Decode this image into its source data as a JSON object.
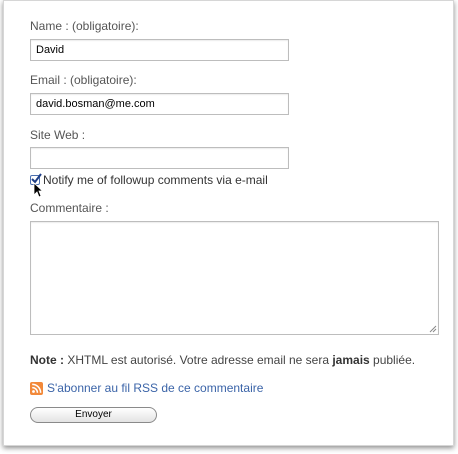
{
  "form": {
    "name_label": "Name : (obligatoire):",
    "name_value": "David",
    "email_label": "Email : (obligatoire):",
    "email_value": "david.bosman@me.com",
    "website_label": "Site Web :",
    "website_value": "",
    "notify_label": "Notify me of followup comments via e-mail",
    "notify_checked": true,
    "comment_label": "Commentaire :",
    "comment_value": ""
  },
  "note": {
    "prefix": "Note :",
    "text_before": " XHTML est autorisé. Votre adresse email ne sera ",
    "emphasis": "jamais",
    "text_after": " publiée."
  },
  "rss": {
    "icon": "rss-icon",
    "link_text": "S'abonner au fil RSS de ce commentaire"
  },
  "submit": {
    "label": "Envoyer"
  },
  "colors": {
    "link": "#3b64a8",
    "rss": "#f2893a",
    "label": "#555555"
  }
}
